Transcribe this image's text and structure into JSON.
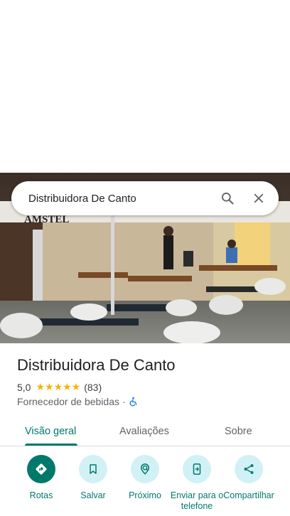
{
  "search": {
    "query": "Distribuidora De Canto"
  },
  "photo": {
    "sign_text": "AMSTEL"
  },
  "place": {
    "name": "Distribuidora De Canto",
    "rating": "5,0",
    "stars": "★★★★★",
    "reviews_count": "(83)",
    "category": "Fornecedor de bebidas",
    "separator": "·"
  },
  "tabs": [
    {
      "label": "Visão geral",
      "active": true
    },
    {
      "label": "Avaliações",
      "active": false
    },
    {
      "label": "Sobre",
      "active": false
    }
  ],
  "actions": [
    {
      "label": "Rotas",
      "icon": "directions-icon"
    },
    {
      "label": "Salvar",
      "icon": "bookmark-icon"
    },
    {
      "label": "Próximo",
      "icon": "nearby-icon"
    },
    {
      "label": "Enviar para o telefone",
      "icon": "send-to-phone-icon"
    },
    {
      "label": "Compartilhar",
      "icon": "share-icon"
    }
  ],
  "colors": {
    "accent": "#00796b",
    "star": "#f6b400",
    "action_bg": "#d2f1f6"
  }
}
